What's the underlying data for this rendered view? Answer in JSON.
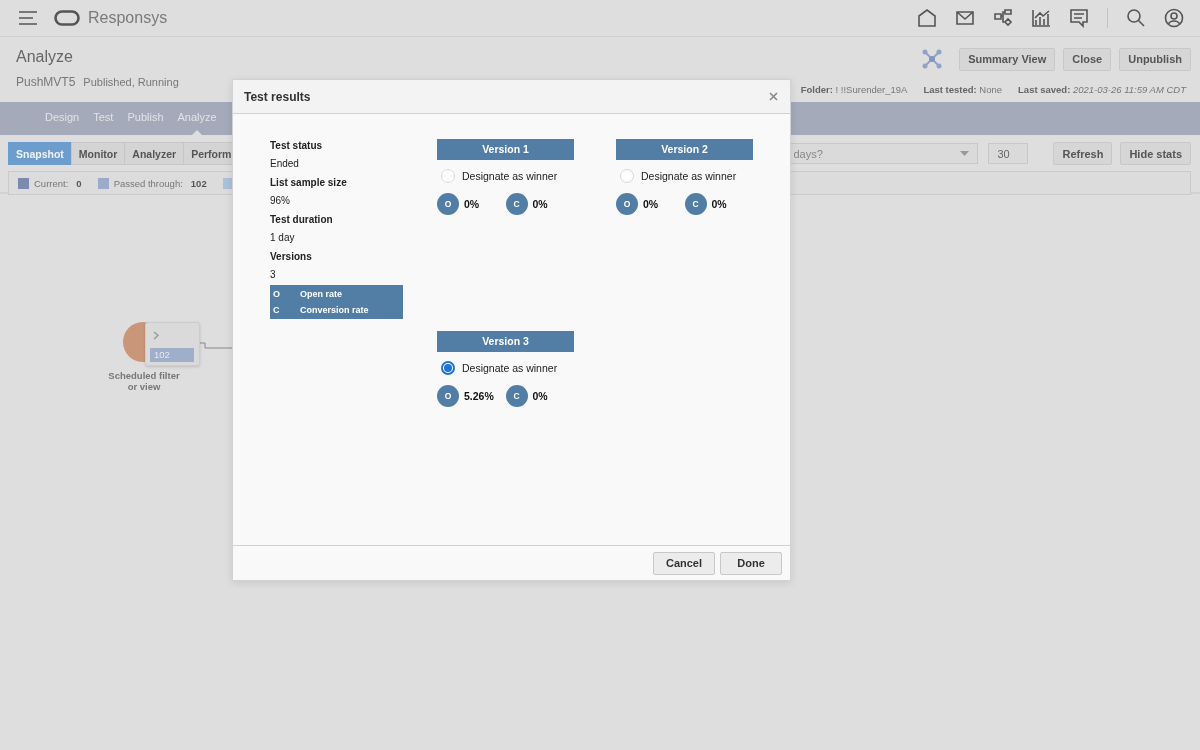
{
  "header": {
    "brand": "Responsys"
  },
  "page": {
    "title": "Analyze",
    "name": "PushMVT5",
    "status": "Published, Running",
    "buttons": [
      "Summary View",
      "Close",
      "Unpublish"
    ],
    "meta": [
      {
        "label": "Folder:",
        "value": "! !!Surender_19A",
        "kind": "text"
      },
      {
        "label": "Last tested:",
        "value": "None",
        "kind": "text"
      },
      {
        "label": "Last saved:",
        "value": "2021-03-26 11:59 AM CDT",
        "kind": "date"
      }
    ]
  },
  "steps": [
    {
      "label": "Design",
      "selected": false
    },
    {
      "label": "Test",
      "selected": false
    },
    {
      "label": "Publish",
      "selected": false
    },
    {
      "label": "Analyze",
      "selected": true
    }
  ],
  "view_tabs": [
    {
      "label": "Snapshot",
      "selected": true
    },
    {
      "label": "Monitor",
      "selected": false
    },
    {
      "label": "Analyzer",
      "selected": false
    },
    {
      "label": "Perform",
      "selected": false
    }
  ],
  "period": {
    "value": "days?"
  },
  "days_field": {
    "value": "30"
  },
  "toolbar_buttons": [
    "Refresh",
    "Hide stats"
  ],
  "legend": [
    {
      "label": "Current:",
      "value": "0",
      "color": "#7b8bb0"
    },
    {
      "label": "Passed through:",
      "value": "102",
      "color": "#9aabcb"
    },
    {
      "color": "#a9c2d9"
    }
  ],
  "node": {
    "label": "Scheduled filter or view",
    "count": "102"
  },
  "dialog": {
    "title": "Test results",
    "summary": [
      {
        "label": "Test status",
        "value": "Ended"
      },
      {
        "label": "List sample size",
        "value": "96%"
      },
      {
        "label": "Test duration",
        "value": "1 day"
      },
      {
        "label": "Versions",
        "value": "3"
      }
    ],
    "key": [
      {
        "key": "O",
        "label": "Open rate"
      },
      {
        "key": "C",
        "label": "Conversion rate"
      }
    ],
    "versions": [
      {
        "title": "Version 1",
        "winner_label": "Designate as winner",
        "selected": false,
        "metrics": [
          {
            "key": "O",
            "value": "0%"
          },
          {
            "key": "C",
            "value": "0%"
          }
        ]
      },
      {
        "title": "Version 2",
        "winner_label": "Designate as winner",
        "selected": false,
        "metrics": [
          {
            "key": "O",
            "value": "0%"
          },
          {
            "key": "C",
            "value": "0%"
          }
        ]
      },
      {
        "title": "Version 3",
        "winner_label": "Designate as winner",
        "selected": true,
        "metrics": [
          {
            "key": "O",
            "value": "5.26%"
          },
          {
            "key": "C",
            "value": "0%"
          }
        ]
      }
    ],
    "buttons": [
      "Cancel",
      "Done"
    ]
  }
}
